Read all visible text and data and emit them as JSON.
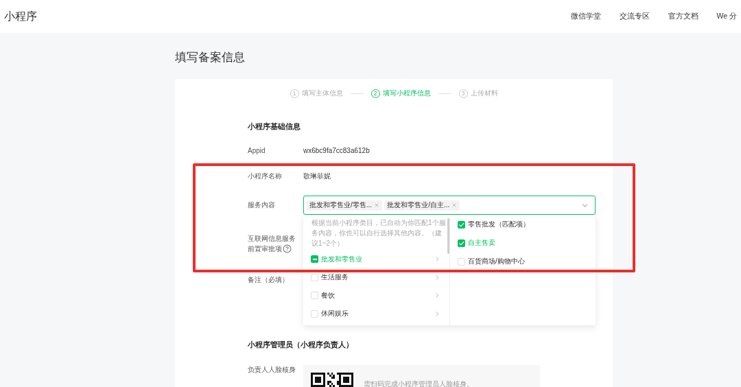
{
  "header": {
    "logo": "小程序",
    "nav": [
      "微信学堂",
      "交流专区",
      "官方文档",
      "We 分"
    ]
  },
  "page_title": "填写备案信息",
  "steps": [
    {
      "number": "1",
      "label": "填写主体信息",
      "selected": false
    },
    {
      "number": "2",
      "label": "填写小程序信息",
      "selected": true
    },
    {
      "number": "3",
      "label": "上传材料",
      "selected": false
    }
  ],
  "basic_info": {
    "title": "小程序基础信息",
    "fields": [
      {
        "kind": "text",
        "label": "Appid",
        "value": "wx6bc9fa7cc83a612b"
      },
      {
        "kind": "text",
        "label": "小程序名称",
        "value": "歌琳菲妮"
      },
      {
        "kind": "select",
        "label": "服务内容",
        "expanded": true,
        "tags": [
          "批发和零售业/零售...",
          "批发和零售业/自主..."
        ],
        "dropdown": {
          "hint": "根据当前小程序类目，已自动为你匹配1个服务内容，你也可以自行选择其他内容。（建议1~2个）",
          "categories": [
            {
              "label": "批发和零售业",
              "checked": false,
              "indeterminate": true,
              "selected": true
            },
            {
              "label": "生活服务",
              "checked": false,
              "indeterminate": false,
              "selected": false
            },
            {
              "label": "餐饮",
              "checked": false,
              "indeterminate": false,
              "selected": false
            },
            {
              "label": "休闲娱乐",
              "checked": false,
              "indeterminate": false,
              "selected": false
            }
          ],
          "options": [
            {
              "label": "零售批发（匹配项）",
              "checked": true,
              "selected": false
            },
            {
              "label": "自主售卖",
              "checked": true,
              "selected": true
            },
            {
              "label": "百货商场/购物中心",
              "checked": false,
              "selected": false
            }
          ]
        }
      },
      {
        "kind": "help",
        "label_lines": [
          "互联网信息服务",
          "前置审批项"
        ]
      },
      {
        "kind": "textarea",
        "label": "备注（必填）"
      }
    ]
  },
  "admin": {
    "title": "小程序管理员（小程序负责人）",
    "fields": [
      {
        "kind": "face_verify",
        "label": "负责人人脸核身",
        "hint": "需扫码完成小程序管理员人脸核身。"
      }
    ]
  }
}
